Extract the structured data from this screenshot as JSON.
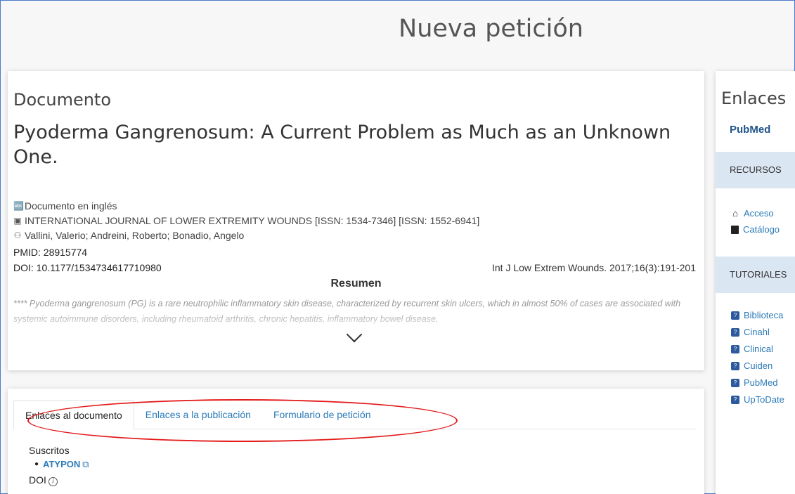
{
  "page": {
    "title": "Nueva petición"
  },
  "document": {
    "heading": "Documento",
    "title": "Pyoderma Gangrenosum: A Current Problem as Much as an Unknown One.",
    "language": "Documento en inglés",
    "journal": "INTERNATIONAL JOURNAL OF LOWER EXTREMITY WOUNDS [ISSN: 1534-7346] [ISSN: 1552-6941]",
    "authors": "Vallini, Valerio; Andreini, Roberto; Bonadio, Angelo",
    "pmid": "PMID: 28915774",
    "doi": "DOI: 10.1177/1534734617710980",
    "citation": "Int J Low Extrem Wounds. 2017;16(3):191-201",
    "abstract_heading": "Resumen",
    "abstract_text": "**** Pyoderma gangrenosum (PG) is a rare neutrophilic inflammatory skin disease, characterized by recurrent skin ulcers, which in almost 50% of cases are associated with systemic autoimmune disorders, including rheumatoid arthritis, chronic hepatitis, inflammatory bowel disease,"
  },
  "links": {
    "tabs": [
      {
        "label": "Enlaces al documento",
        "active": true
      },
      {
        "label": "Enlaces a la publicación",
        "active": false
      },
      {
        "label": "Formulario de petición",
        "active": false
      }
    ],
    "subscribed_label": "Suscritos",
    "providers": [
      {
        "label": "ATYPON"
      }
    ],
    "doi_label": "DOI",
    "annotation_color": "#e31b1b"
  },
  "sidebar": {
    "heading": "Enlaces",
    "logo_text": "PubMed",
    "resources_label": "RECURSOS",
    "resources": [
      {
        "label": "Acceso",
        "icon": "home-icon"
      },
      {
        "label": "Catálogo",
        "icon": "book-icon"
      }
    ],
    "tutorials_label": "TUTORIALES",
    "tutorials": [
      {
        "label": "Biblioteca"
      },
      {
        "label": "Cinahl"
      },
      {
        "label": "Clinical"
      },
      {
        "label": "Cuiden"
      },
      {
        "label": "PubMed"
      },
      {
        "label": "UpToDate"
      }
    ]
  },
  "colors": {
    "accent": "#2a7ab8",
    "sidebar_bar": "#dbe6f3",
    "frame_border": "#4a7cc9"
  }
}
